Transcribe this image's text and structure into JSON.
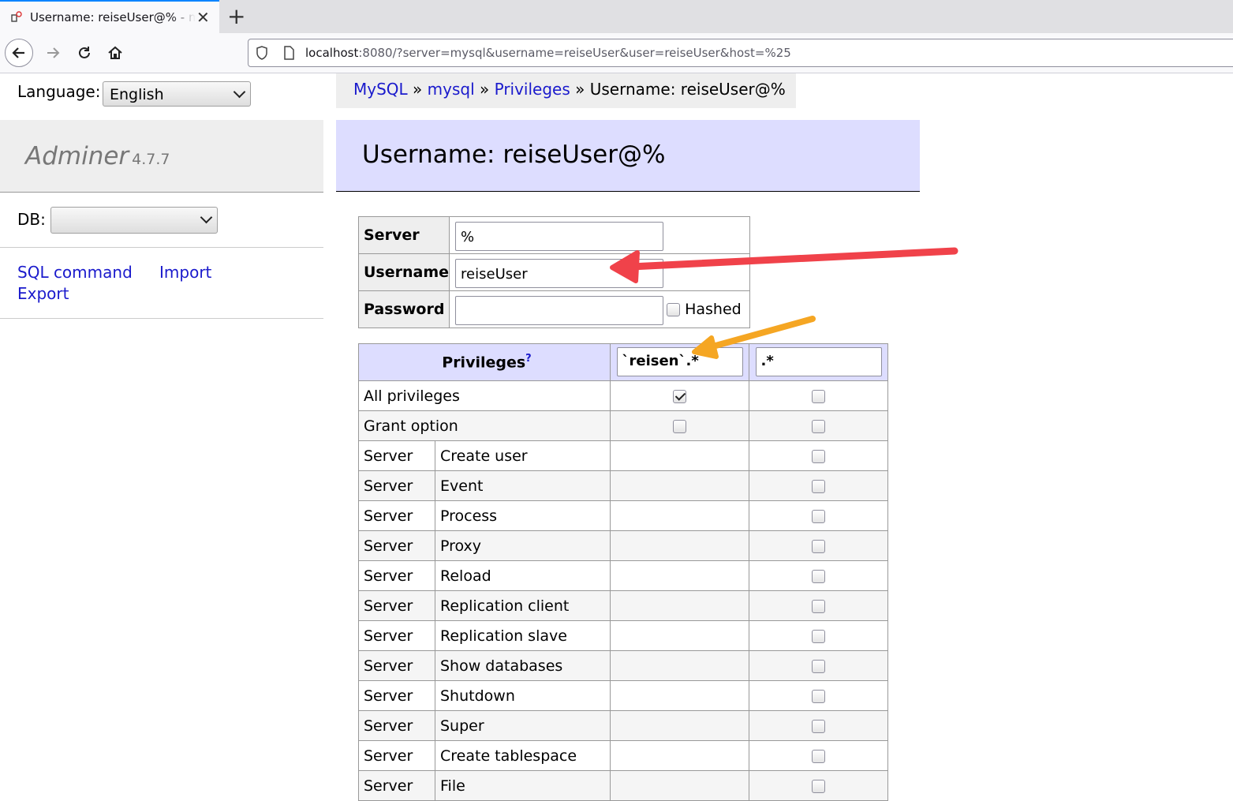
{
  "browser": {
    "tab_title": "Username: reiseUser@% - my",
    "new_tab_label": "+",
    "url_host": "localhost",
    "url_rest": ":8080/?server=mysql&username=reiseUser&user=reiseUser&host=%25"
  },
  "sidebar": {
    "language_label": "Language:",
    "language_value": "English",
    "app_name": "Adminer",
    "app_version": "4.7.7",
    "db_label": "DB:",
    "db_value": "",
    "links": {
      "sql_command": "SQL command",
      "import": "Import",
      "export": "Export"
    }
  },
  "breadcrumb": {
    "items": [
      "MySQL",
      "mysql",
      "Privileges"
    ],
    "separator": "»",
    "current": "Username: reiseUser@%"
  },
  "page_title": "Username: reiseUser@%",
  "credentials": {
    "server_label": "Server",
    "server_value": "%",
    "username_label": "Username",
    "username_value": "reiseUser",
    "password_label": "Password",
    "password_value": "",
    "hashed_label": "Hashed",
    "hashed_checked": false
  },
  "privileges": {
    "header": "Privileges",
    "help_mark": "?",
    "columns": [
      "`reisen`.*",
      ".*"
    ],
    "top_rows": [
      {
        "label": "All privileges",
        "col1": true,
        "col2": false
      },
      {
        "label": "Grant option",
        "col1": false,
        "col2": false
      }
    ],
    "rows": [
      {
        "context": "Server",
        "privilege": "Create user",
        "col2": false
      },
      {
        "context": "Server",
        "privilege": "Event",
        "col2": false
      },
      {
        "context": "Server",
        "privilege": "Process",
        "col2": false
      },
      {
        "context": "Server",
        "privilege": "Proxy",
        "col2": false
      },
      {
        "context": "Server",
        "privilege": "Reload",
        "col2": false
      },
      {
        "context": "Server",
        "privilege": "Replication client",
        "col2": false
      },
      {
        "context": "Server",
        "privilege": "Replication slave",
        "col2": false
      },
      {
        "context": "Server",
        "privilege": "Show databases",
        "col2": false
      },
      {
        "context": "Server",
        "privilege": "Shutdown",
        "col2": false
      },
      {
        "context": "Server",
        "privilege": "Super",
        "col2": false
      },
      {
        "context": "Server",
        "privilege": "Create tablespace",
        "col2": false
      },
      {
        "context": "Server",
        "privilege": "File",
        "col2": false
      }
    ]
  },
  "colors": {
    "link": "#1a1acc",
    "header_bg": "#ddf",
    "red_arrow": "#f0424a",
    "yellow_arrow": "#f5a623"
  }
}
